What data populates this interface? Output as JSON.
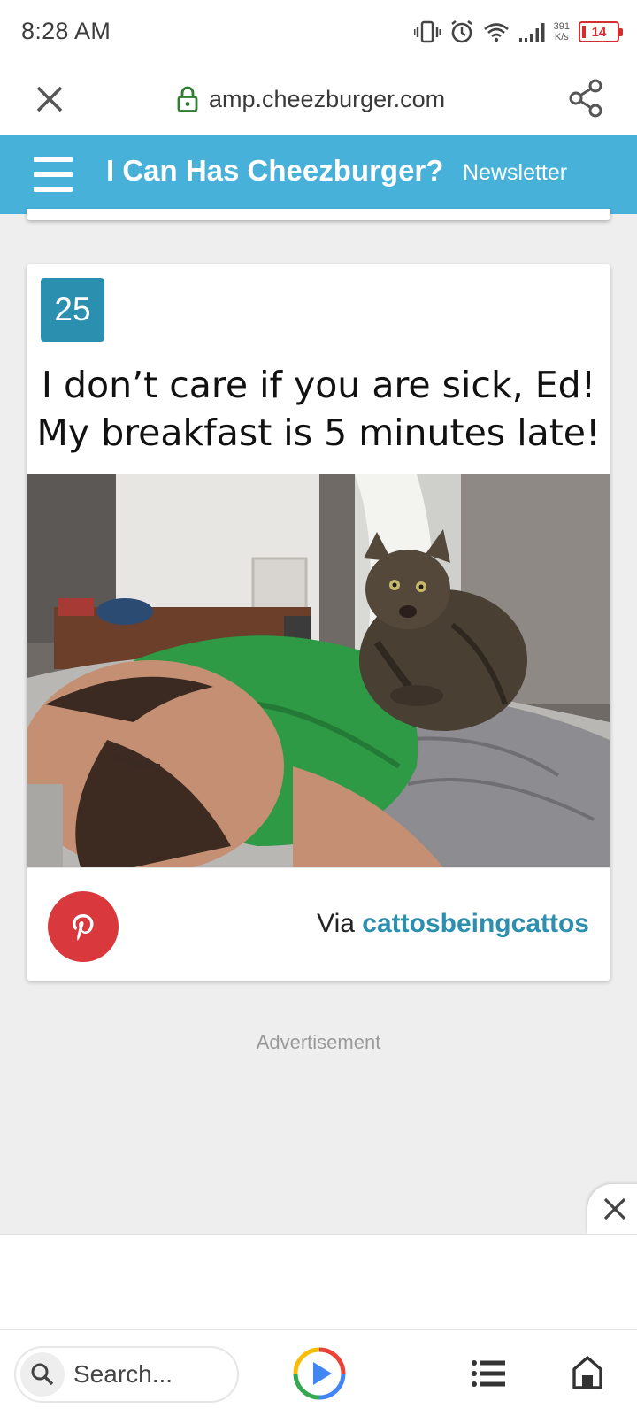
{
  "status_bar": {
    "time": "8:28 AM",
    "net_speed_value": "391",
    "net_speed_unit": "K/s",
    "battery_level": "14",
    "icons": [
      "vibrate-icon",
      "alarm-icon",
      "wifi-icon",
      "signal-icon",
      "battery-icon"
    ]
  },
  "browser": {
    "url": "amp.cheezburger.com",
    "icons": [
      "close-icon",
      "lock-icon",
      "share-icon"
    ]
  },
  "site_header": {
    "title": "I Can Has Cheezburger?",
    "newsletter_label": "Newsletter",
    "menu_icon": "hamburger-menu-icon"
  },
  "card": {
    "number": "25",
    "caption_line1": "I don’t care if you are sick, Ed!",
    "caption_line2": "My breakfast is 5 minutes late!",
    "via_prefix": "Via",
    "via_source": "cattosbeingcattos",
    "pin_icon": "pinterest-icon"
  },
  "ad": {
    "label": "Advertisement",
    "close_icon": "close-icon"
  },
  "bottom_bar": {
    "search_placeholder": "Search...",
    "icons": [
      "search-icon",
      "play-icon",
      "list-icon",
      "home-icon"
    ]
  },
  "colors": {
    "header_bg": "#48b1d9",
    "badge_bg": "#2b8fb0",
    "link": "#2b8fb0",
    "pinterest": "#d9383c",
    "secure_lock": "#2e7d32",
    "battery_low": "#d32f2f",
    "page_bg": "#eeeeee"
  }
}
